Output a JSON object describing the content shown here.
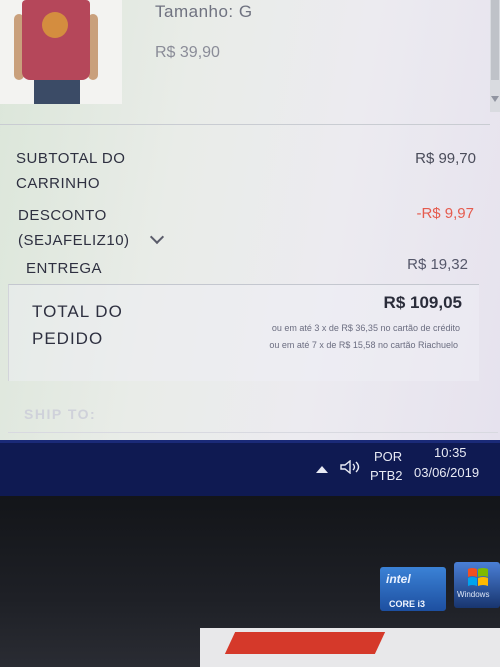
{
  "product": {
    "size_label": "Tamanho: G",
    "price": "R$ 39,90"
  },
  "summary": {
    "subtotal_label": "SUBTOTAL DO CARRINHO",
    "subtotal_value": "R$ 99,70",
    "discount_label": "DESCONTO",
    "discount_code": "(SEJAFELIZ10)",
    "discount_value": "-R$ 9,97",
    "shipping_label": "ENTREGA",
    "shipping_value": "R$ 19,32",
    "total_label": "TOTAL DO PEDIDO",
    "total_value": "R$ 109,05",
    "installments": [
      "ou em até 3 x de R$ 36,35 no cartão de crédito",
      "ou em até 7 x de R$ 15,58 no cartão Riachuelo"
    ]
  },
  "ship_to_label": "SHIP TO:",
  "taskbar": {
    "lang_top": "POR",
    "lang_bottom": "PTB2",
    "time": "10:35",
    "date": "03/06/2019"
  },
  "stickers": {
    "intel_logo": "intel",
    "intel_model": "CORE i3",
    "windows_label": "Windows"
  },
  "colors": {
    "discount": "#e55b4e",
    "taskbar": "#0f1a52"
  }
}
